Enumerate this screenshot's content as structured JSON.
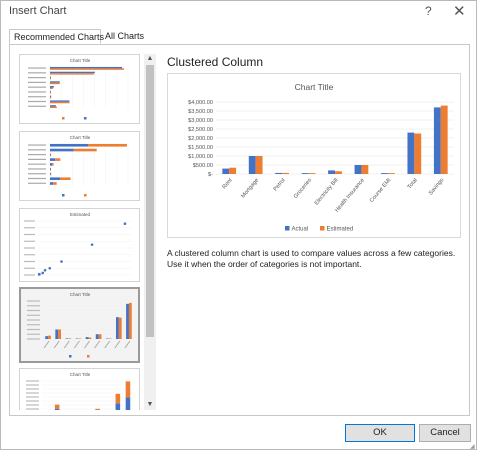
{
  "window": {
    "title": "Insert Chart",
    "help_label": "?",
    "close_label": "✕"
  },
  "tabs": [
    {
      "label": "Recommended Charts",
      "active": true
    },
    {
      "label": "All Charts",
      "active": false
    }
  ],
  "selected_chart": {
    "name": "Clustered Column",
    "description": "A clustered column chart is used to compare values across a few categories. Use it when the order of categories is not important."
  },
  "thumbnails": [
    {
      "kind": "clustered-bar",
      "title": "Chart Title"
    },
    {
      "kind": "stacked-bar",
      "title": "Chart Title"
    },
    {
      "kind": "scatter",
      "title": "Estimated"
    },
    {
      "kind": "clustered-column",
      "title": "Chart Title",
      "selected": true
    },
    {
      "kind": "stacked-column",
      "title": "Chart Title"
    }
  ],
  "colors": {
    "actual": "#4472C4",
    "estimated": "#ED7D31",
    "ok_border": "#0078d7"
  },
  "chart_data": {
    "type": "bar",
    "title": "Chart Title",
    "categories": [
      "Rent",
      "Mortgage",
      "Petrol",
      "Groceries",
      "Electricity Bill",
      "Health Insurance",
      "Course EMI",
      "Total",
      "Savings"
    ],
    "series": [
      {
        "name": "Actual",
        "values": [
          300,
          1000,
          60,
          50,
          200,
          500,
          50,
          2300,
          3700
        ]
      },
      {
        "name": "Estimated",
        "values": [
          350,
          1000,
          60,
          50,
          150,
          500,
          50,
          2250,
          3800
        ]
      }
    ],
    "ylim": [
      0,
      4000
    ],
    "yticks": [
      "$4,000.00",
      "$3,500.00",
      "$3,000.00",
      "$2,500.00",
      "$2,000.00",
      "$1,500.00",
      "$1,000.00",
      "$500.00",
      "$-"
    ],
    "legend_placement": "bottom",
    "grid": true
  },
  "buttons": {
    "ok": "OK",
    "cancel": "Cancel"
  }
}
